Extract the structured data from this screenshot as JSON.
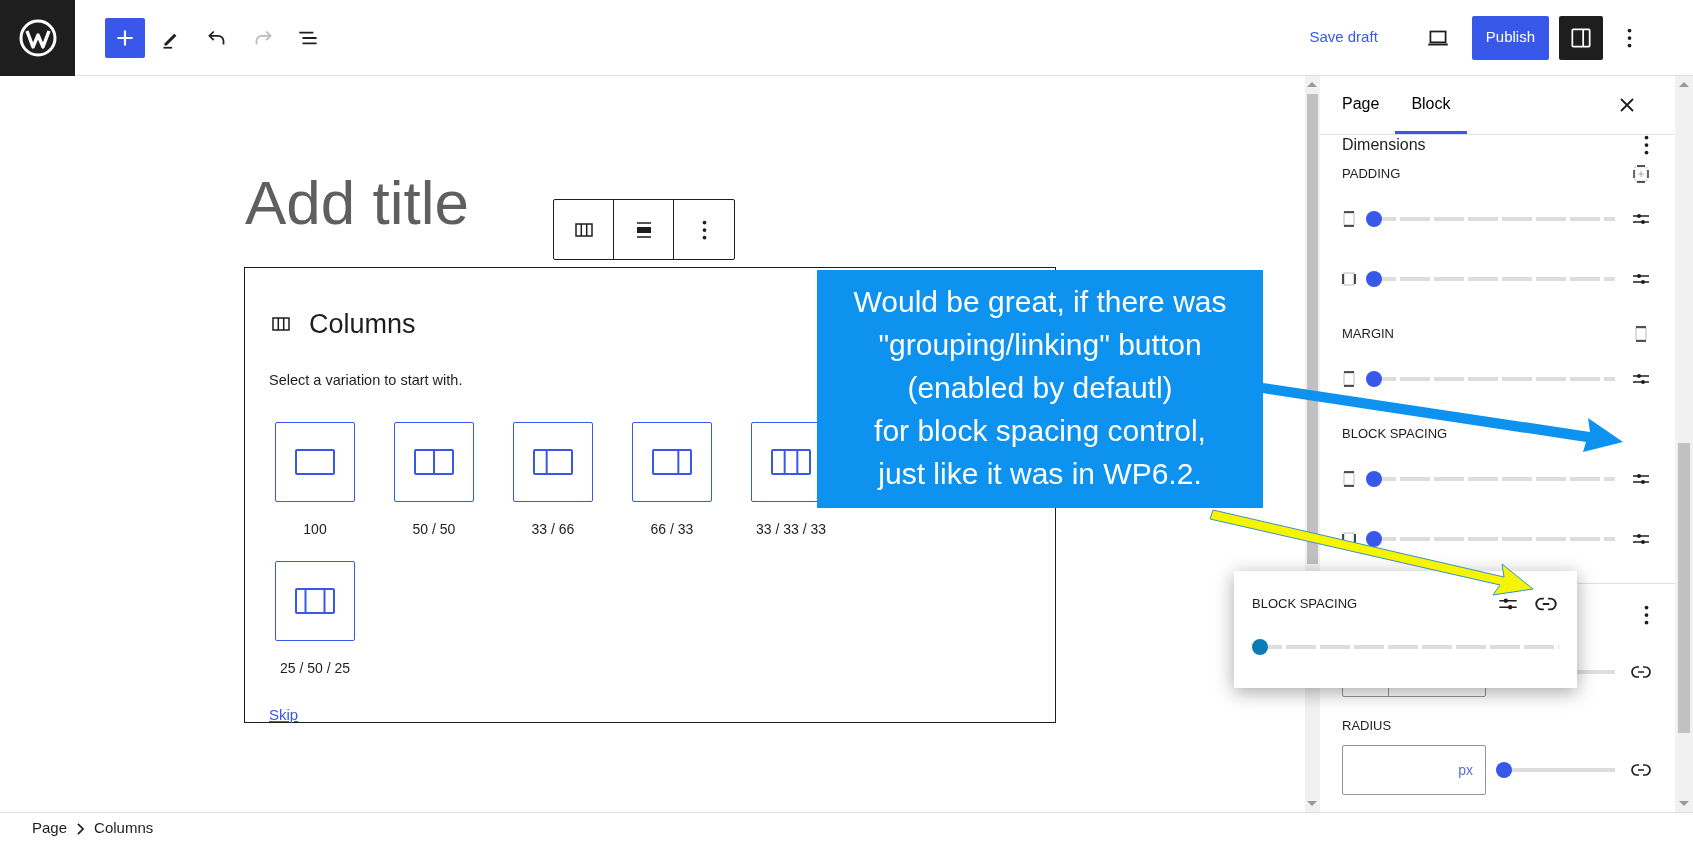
{
  "top_bar": {
    "tools": [
      {
        "kind": "add",
        "disabled": false
      },
      {
        "kind": "edit",
        "disabled": false
      },
      {
        "kind": "undo",
        "disabled": false
      },
      {
        "kind": "redo",
        "disabled": true
      },
      {
        "kind": "list",
        "disabled": false
      }
    ],
    "save_draft": "Save draft",
    "publish": "Publish",
    "sidebar_toggle": {
      "pressed": true
    }
  },
  "editor": {
    "title_placeholder": "Add title",
    "placeholder": {
      "title": "Columns",
      "instructions": "Select a variation to start with.",
      "variations": [
        {
          "label": "100",
          "kind": "single"
        },
        {
          "label": "50 / 50",
          "kind": "halves"
        },
        {
          "label": "33 / 66",
          "kind": "narrow-wide"
        },
        {
          "label": "66 / 33",
          "kind": "wide-narrow"
        },
        {
          "label": "33 / 33 / 33",
          "kind": "thirds"
        },
        {
          "label": "25 / 50 / 25",
          "kind": "wide-center"
        }
      ],
      "skip": "Skip"
    }
  },
  "sidebar": {
    "tabs": [
      {
        "label": "Page",
        "selected": false
      },
      {
        "label": "Block",
        "selected": true
      }
    ],
    "panel_title": "Dimensions",
    "sections": [
      {
        "label": "PADDING",
        "rows": [
          {
            "kind": "vertical",
            "level": 0
          },
          {
            "kind": "horizontal",
            "level": 0
          }
        ]
      },
      {
        "label": "MARGIN",
        "rows": [
          {
            "kind": "vertical",
            "level": 0
          }
        ]
      },
      {
        "label": "BLOCK SPACING",
        "rows": [
          {
            "kind": "vertical",
            "level": 0
          },
          {
            "kind": "horizontal",
            "level": 0
          }
        ]
      }
    ],
    "radius": {
      "label": "RADIUS",
      "unit": "px",
      "level": 0
    }
  },
  "popover": {
    "label": "BLOCK SPACING",
    "level": 0
  },
  "annotation": {
    "text": "Would be great, if there was\n\"grouping/linking\" button\n(enabled by defautl)\nfor block spacing control,\njust like it was in WP6.2."
  },
  "breadcrumbs": [
    "Page",
    "Columns"
  ]
}
